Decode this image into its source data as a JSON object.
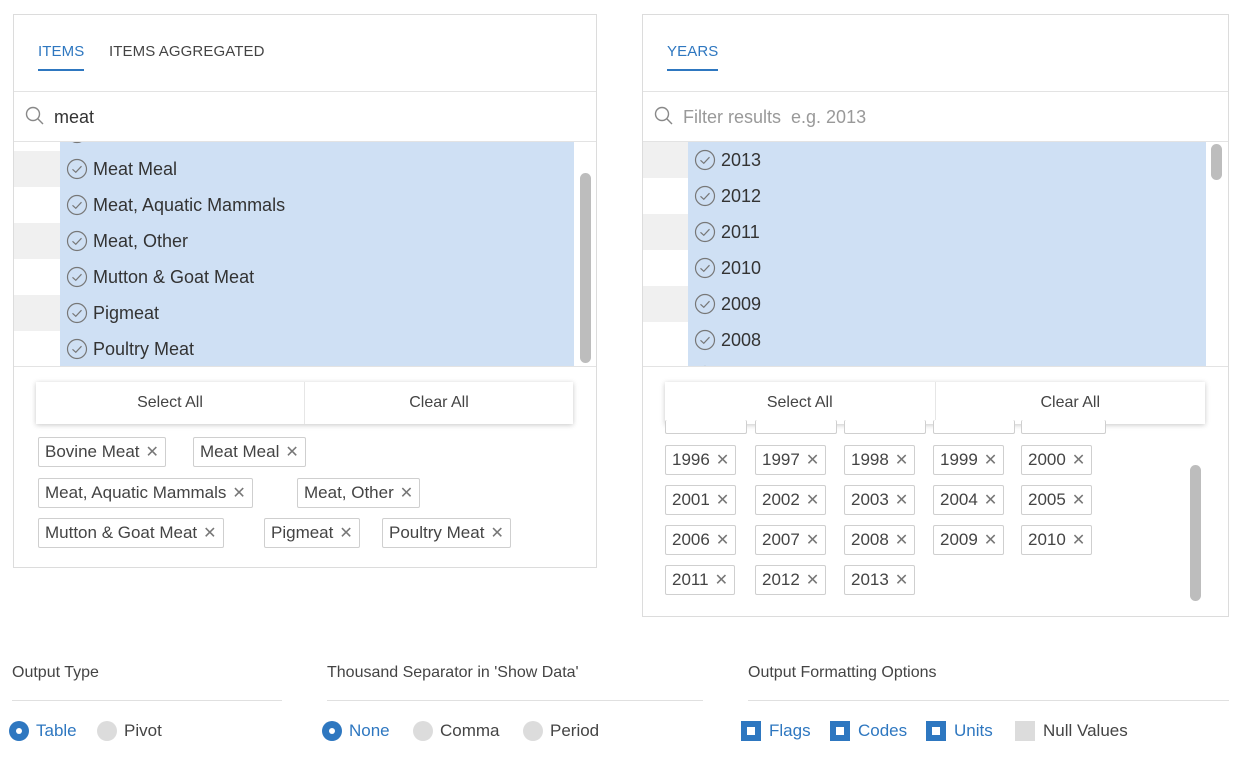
{
  "items_panel": {
    "tabs": [
      {
        "label": "ITEMS",
        "active": true
      },
      {
        "label": "ITEMS AGGREGATED",
        "active": false
      }
    ],
    "search_value": "meat",
    "list": [
      "Meat Meal",
      "Meat, Aquatic Mammals",
      "Meat, Other",
      "Mutton & Goat Meat",
      "Pigmeat",
      "Poultry Meat"
    ],
    "select_all": "Select All",
    "clear_all": "Clear All",
    "chips": [
      "Bovine Meat",
      "Meat Meal",
      "Meat, Aquatic Mammals",
      "Meat, Other",
      "Mutton & Goat Meat",
      "Pigmeat",
      "Poultry Meat"
    ]
  },
  "years_panel": {
    "tabs": [
      {
        "label": "YEARS",
        "active": true
      }
    ],
    "search_placeholder": "Filter results  e.g. 2013",
    "list": [
      "2013",
      "2012",
      "2011",
      "2010",
      "2009",
      "2008"
    ],
    "select_all": "Select All",
    "clear_all": "Clear All",
    "chips": [
      "1996",
      "1997",
      "1998",
      "1999",
      "2000",
      "2001",
      "2002",
      "2003",
      "2004",
      "2005",
      "2006",
      "2007",
      "2008",
      "2009",
      "2010",
      "2011",
      "2012",
      "2013"
    ]
  },
  "output_type": {
    "title": "Output Type",
    "options": [
      {
        "label": "Table",
        "selected": true
      },
      {
        "label": "Pivot",
        "selected": false
      }
    ]
  },
  "thousand_separator": {
    "title": "Thousand Separator in 'Show Data'",
    "options": [
      {
        "label": "None",
        "selected": true
      },
      {
        "label": "Comma",
        "selected": false
      },
      {
        "label": "Period",
        "selected": false
      }
    ]
  },
  "output_formatting": {
    "title": "Output Formatting Options",
    "options": [
      {
        "label": "Flags",
        "checked": true
      },
      {
        "label": "Codes",
        "checked": true
      },
      {
        "label": "Units",
        "checked": true
      },
      {
        "label": "Null Values",
        "checked": false
      }
    ]
  },
  "colors": {
    "accent": "#2e77c0",
    "selected_row": "#cfe0f4",
    "stripe": "#f0f0f0"
  },
  "icons": [
    "search-icon",
    "check-circle-icon",
    "close-icon"
  ]
}
